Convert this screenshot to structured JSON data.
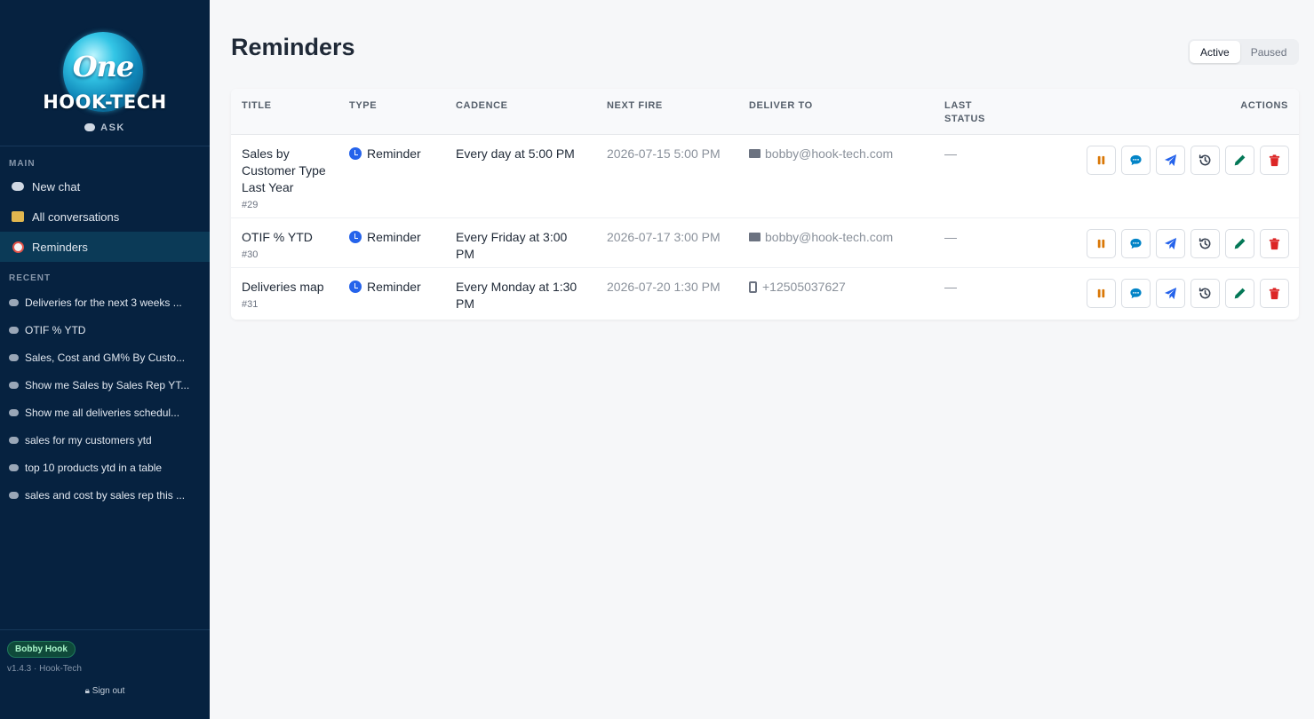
{
  "sidebar": {
    "logo_word": "One",
    "brand": "HOOK-TECH",
    "ask_label": "ASK",
    "main_label": "MAIN",
    "nav": [
      {
        "label": "New chat",
        "icon": "chat-icon"
      },
      {
        "label": "All conversations",
        "icon": "folder-icon"
      },
      {
        "label": "Reminders",
        "icon": "alarm-clock-icon",
        "active": true
      }
    ],
    "recent_label": "RECENT",
    "recent": [
      "Deliveries for the next 3 weeks ...",
      "OTIF % YTD",
      "Sales, Cost and GM% By Custo...",
      "Show me Sales by Sales Rep YT...",
      "Show me all deliveries schedul...",
      "sales for my customers ytd",
      "top 10 products ytd in a table",
      "sales and cost by sales rep this ..."
    ],
    "user": "Bobby Hook",
    "version": "v1.4.3 · Hook-Tech",
    "signout": "Sign out"
  },
  "main": {
    "title": "Reminders",
    "filter": {
      "active": "Active",
      "paused": "Paused",
      "selected": "Active"
    },
    "columns": {
      "title": "TITLE",
      "type": "TYPE",
      "cadence": "CADENCE",
      "next_fire": "NEXT FIRE",
      "deliver_to": "DELIVER TO",
      "last_status_1": "LAST",
      "last_status_2": "STATUS",
      "actions": "ACTIONS"
    },
    "rows": [
      {
        "title": "Sales by Customer Type Last Year",
        "id": "#29",
        "type": "Reminder",
        "cadence": "Every day at 5:00 PM",
        "next_fire": "2026-07-15 5:00 PM",
        "deliver_to": "bobby@hook-tech.com",
        "channel": "email",
        "last_status": "—"
      },
      {
        "title": "OTIF % YTD",
        "id": "#30",
        "type": "Reminder",
        "cadence": "Every Friday at 3:00 PM",
        "next_fire": "2026-07-17 3:00 PM",
        "deliver_to": "bobby@hook-tech.com",
        "channel": "email",
        "last_status": "—"
      },
      {
        "title": "Deliveries map",
        "id": "#31",
        "type": "Reminder",
        "cadence": "Every Monday at 1:30 PM",
        "next_fire": "2026-07-20 1:30 PM",
        "deliver_to": "+12505037627",
        "channel": "phone",
        "last_status": "—"
      }
    ]
  },
  "colors": {
    "sidebar_bg": "#062240",
    "active_nav_bg": "#0b3a57",
    "pause": "#d97706",
    "chat": "#0284c7",
    "send": "#2563eb",
    "history": "#374151",
    "edit": "#047857",
    "delete": "#dc2626"
  }
}
